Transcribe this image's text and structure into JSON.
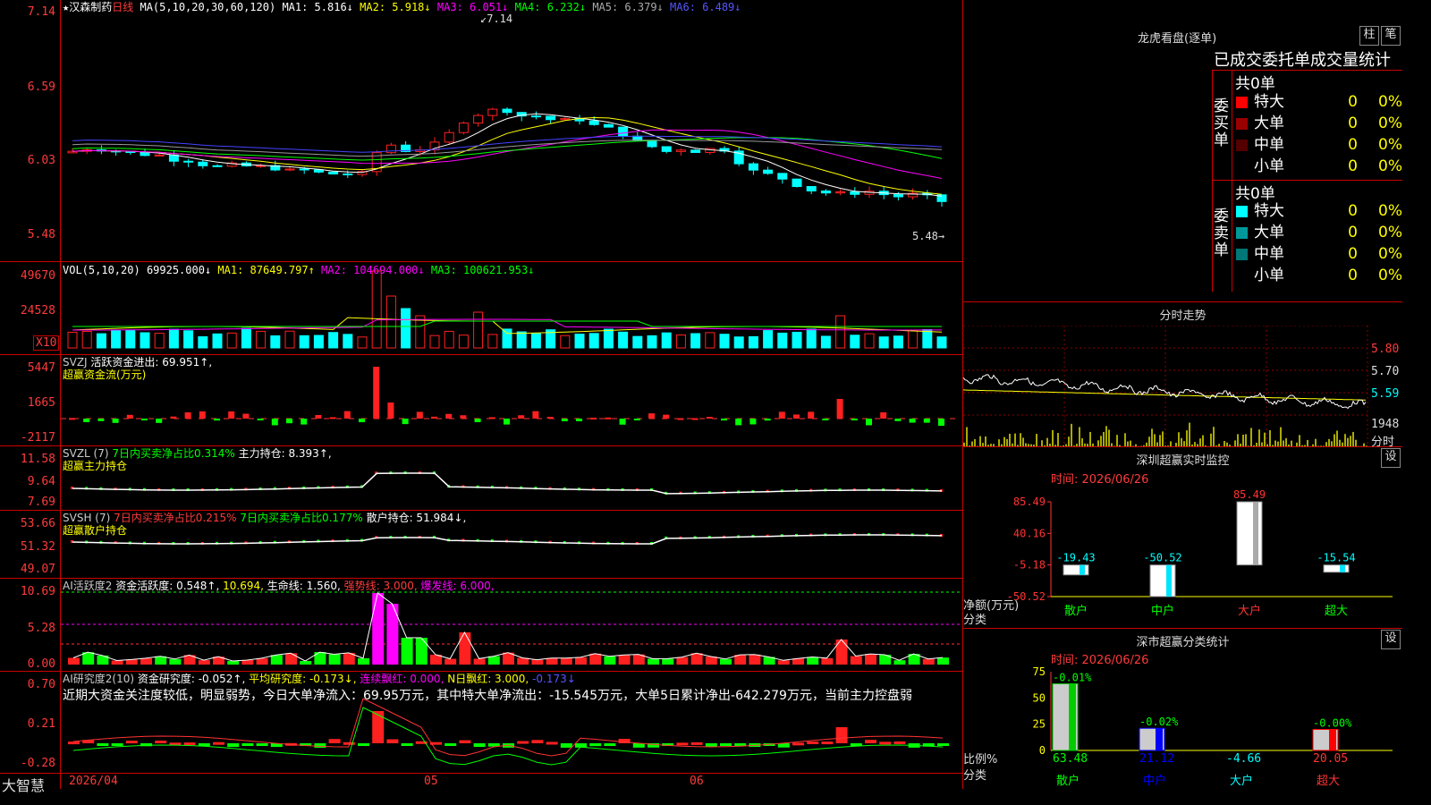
{
  "colors": {
    "up": "#ff2020",
    "down": "#00ffff",
    "frame": "#cc0000",
    "ma1": "#ffffff",
    "ma2": "#ffff00",
    "ma3": "#ff00ff",
    "ma4": "#00ff00",
    "ma5": "#808080",
    "ma6": "#4040ff"
  },
  "kline": {
    "title": "★汉森制药",
    "period": "日线",
    "ma_label": "MA(5,10,20,30,60,120)",
    "ma1": "MA1: 5.816↓",
    "ma2": "MA2: 5.918↓",
    "ma3": "MA3: 6.051↓",
    "ma4": "MA4: 6.232↓",
    "ma5": "MA5: 6.379↓",
    "ma6": "MA6: 6.489↓",
    "y_ticks": [
      "7.14",
      "6.59",
      "6.03",
      "5.48"
    ],
    "high_mark": "7.14",
    "low_mark": "5.48→",
    "min": 5.48,
    "max": 7.14
  },
  "vol": {
    "label": "VOL(5,10,20)",
    "value": "69925.000↓",
    "ma1": "MA1: 87649.797↑",
    "ma2": "MA2: 104694.000↓",
    "ma3": "MA3: 100621.953↓",
    "y_ticks": [
      "49670",
      "24528"
    ],
    "unit": "X10"
  },
  "svzj": {
    "label": "SVZJ",
    "l1": "活跃资金进出: 69.951↑,",
    "l2": "超赢资金流(万元)",
    "y_ticks": [
      "5447",
      "1665",
      "-2117"
    ]
  },
  "svzl": {
    "label": "SVZL (7)",
    "l1": "7日内买卖净占比0.314%",
    "l2": "主力持仓: 8.393↑,",
    "l3": "超赢主力持仓",
    "y_ticks": [
      "11.58",
      "9.64",
      "7.69"
    ]
  },
  "svsh": {
    "label": "SVSH (7)",
    "l1": "7日内买卖净占比0.215%",
    "l2": "7日内买卖净占比0.177%",
    "l3": "散户持仓: 51.984↓,",
    "l4": "超赢散户持仓",
    "y_ticks": [
      "53.66",
      "51.32",
      "49.07"
    ]
  },
  "ai1": {
    "label": "AI活跃度2",
    "l1": "资金活跃度: 0.548↑,",
    "l2": "10.694,",
    "l3": "生命线: 1.560,",
    "l4": "强势线: 3.000,",
    "l5": "爆发线: 6.000,",
    "y_ticks": [
      "10.69",
      "5.28",
      "0.00"
    ]
  },
  "ai2": {
    "label": "AI研究度2(10)",
    "l1": "资金研究度: -0.052↑,",
    "l2": "平均研究度: -0.173↓,",
    "l3": "连续飘红: 0.000,",
    "l4": "N日飘红: 3.000,",
    "l5": "-0.173↓",
    "comment": "近期大资金关注度较低，明显弱势，今日大单净流入：69.95万元，其中特大单净流出：-15.545万元，大单5日累计净出-642.279万元，当前主力控盘弱",
    "y_ticks": [
      "0.70",
      "0.21",
      "-0.28"
    ]
  },
  "footer": {
    "brand": "大智慧",
    "date": "2026/04",
    "m1": "05",
    "m2": "06"
  },
  "dragon": {
    "title": "龙虎看盘(逐单)",
    "btn1": "柱",
    "btn2": "笔",
    "subtitle": "已成交委托单成交量统计",
    "buy_label": "委买单",
    "buy_total": "共0单",
    "sell_label": "委卖单",
    "sell_total": "共0单",
    "buy_rows": [
      {
        "name": "特大",
        "count": "0",
        "pct": "0%"
      },
      {
        "name": "大单",
        "count": "0",
        "pct": "0%"
      },
      {
        "name": "中单",
        "count": "0",
        "pct": "0%"
      },
      {
        "name": "小单",
        "count": "0",
        "pct": "0%"
      }
    ],
    "sell_rows": [
      {
        "name": "特大",
        "count": "0",
        "pct": "0%"
      },
      {
        "name": "大单",
        "count": "0",
        "pct": "0%"
      },
      {
        "name": "中单",
        "count": "0",
        "pct": "0%"
      },
      {
        "name": "小单",
        "count": "0",
        "pct": "0%"
      }
    ]
  },
  "intraday": {
    "title": "分时走势",
    "y_ticks": [
      "5.80",
      "5.70",
      "5.59"
    ],
    "vol_tick": "1948",
    "vol_label": "分时"
  },
  "monitor": {
    "title": "深圳超赢实时监控",
    "btn": "设",
    "time": "时间: 2026/06/26",
    "y_ticks": [
      "85.49",
      "40.16",
      "-5.18",
      "-50.52"
    ],
    "ylabel": "净额(万元)",
    "xlabel": "分类",
    "chart_data": {
      "type": "bar",
      "categories": [
        "散户",
        "中户",
        "大户",
        "超大"
      ],
      "values": [
        -19.43,
        -50.52,
        85.49,
        -15.54
      ],
      "value_labels": [
        "-19.43",
        "-50.52",
        "85.49",
        "-15.54"
      ],
      "ylim": [
        -50.52,
        85.49
      ]
    }
  },
  "classify": {
    "title": "深市超赢分类统计",
    "btn": "设",
    "time": "时间: 2026/06/26",
    "y_ticks": [
      "75",
      "50",
      "25",
      "0"
    ],
    "ylabel": "比例%",
    "xlabel": "分类",
    "chart_data": {
      "type": "bar",
      "categories": [
        "散户",
        "中户",
        "大户",
        "超大"
      ],
      "values": [
        63.48,
        21.12,
        -4.66,
        20.05
      ],
      "top_labels": [
        "-0.01%",
        "-0.02%",
        "",
        "-0.00%"
      ],
      "ylim": [
        0,
        75
      ]
    }
  }
}
